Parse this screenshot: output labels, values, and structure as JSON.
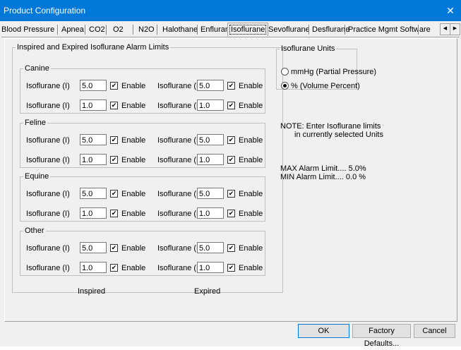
{
  "window": {
    "title": "Product Configuration",
    "close_glyph": "✕"
  },
  "tabs": [
    {
      "label": "Blood Pressure"
    },
    {
      "label": "Apnea"
    },
    {
      "label": "CO2"
    },
    {
      "label": "O2"
    },
    {
      "label": "N2O"
    },
    {
      "label": "Halothane"
    },
    {
      "label": "Enflurane"
    },
    {
      "label": "Isoflurane",
      "active": true
    },
    {
      "label": "Sevoflurane"
    },
    {
      "label": "Desflurane"
    },
    {
      "label": "Practice Mgmt Software"
    }
  ],
  "scroll": {
    "left": "◀",
    "right": "▶"
  },
  "alarm_group": {
    "title": "Inspired and Expired Isoflurane Alarm Limits",
    "enable_label": "Enable",
    "inspired_label": "Isoflurane (I)",
    "expired_label": "Isoflurane (E)",
    "species": [
      {
        "name": "Canine",
        "rows": [
          {
            "i": "5.0",
            "e": "5.0"
          },
          {
            "i": "1.0",
            "e": "1.0"
          }
        ]
      },
      {
        "name": "Feline",
        "rows": [
          {
            "i": "5.0",
            "e": "5.0"
          },
          {
            "i": "1.0",
            "e": "1.0"
          }
        ]
      },
      {
        "name": "Equine",
        "rows": [
          {
            "i": "5.0",
            "e": "5.0"
          },
          {
            "i": "1.0",
            "e": "1.0"
          }
        ]
      },
      {
        "name": "Other",
        "rows": [
          {
            "i": "5.0",
            "e": "5.0"
          },
          {
            "i": "1.0",
            "e": "1.0"
          }
        ]
      }
    ],
    "footer_inspired": "Inspired",
    "footer_expired": "Expired"
  },
  "units_group": {
    "title": "Isoflurane Units",
    "option_mmhg": "mmHg (Partial Pressure)",
    "option_percent": "% (Volume Percent)",
    "selected": "percent"
  },
  "note": {
    "line1": "NOTE: Enter Isoflurane limits",
    "line2": "in currently selected Units"
  },
  "limits": {
    "max": "MAX Alarm Limit.... 5.0%",
    "min": "MIN  Alarm  Limit.... 0.0 %"
  },
  "buttons": {
    "ok": "OK",
    "factory": "Factory Defaults...",
    "cancel": "Cancel"
  }
}
